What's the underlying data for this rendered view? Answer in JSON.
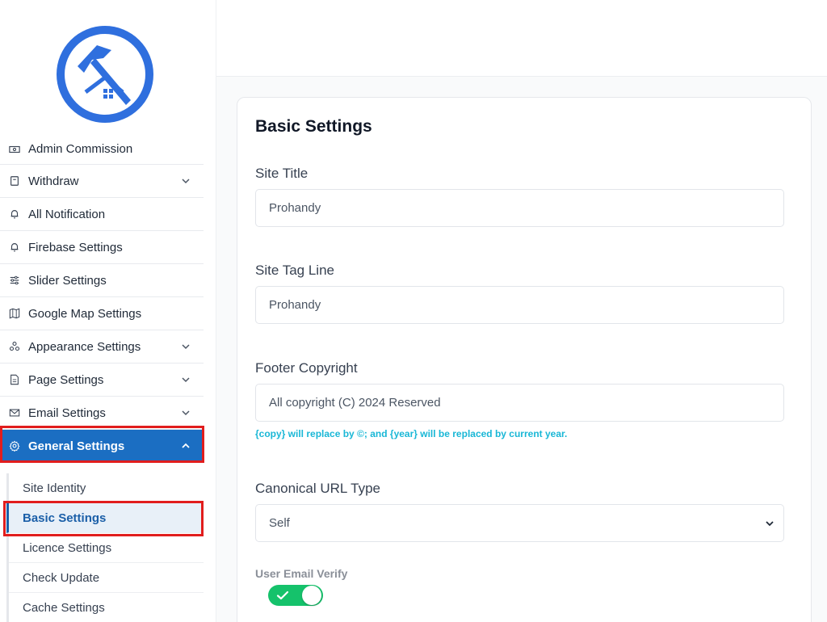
{
  "sidebar": {
    "items": [
      {
        "label": "Admin Commission",
        "icon": "cash-icon",
        "has_chevron": false
      },
      {
        "label": "Withdraw",
        "icon": "wallet-icon",
        "has_chevron": true
      },
      {
        "label": "All Notification",
        "icon": "bell-icon",
        "has_chevron": false
      },
      {
        "label": "Firebase Settings",
        "icon": "bell-icon",
        "has_chevron": false
      },
      {
        "label": "Slider Settings",
        "icon": "sliders-icon",
        "has_chevron": false
      },
      {
        "label": "Google Map Settings",
        "icon": "map-icon",
        "has_chevron": false
      },
      {
        "label": "Appearance Settings",
        "icon": "apps-icon",
        "has_chevron": true
      },
      {
        "label": "Page Settings",
        "icon": "page-icon",
        "has_chevron": true
      },
      {
        "label": "Email Settings",
        "icon": "mail-icon",
        "has_chevron": true
      },
      {
        "label": "General Settings",
        "icon": "gear-icon",
        "has_chevron": true,
        "active": true
      }
    ],
    "submenu": [
      {
        "label": "Site Identity"
      },
      {
        "label": "Basic Settings",
        "active": true
      },
      {
        "label": "Licence Settings"
      },
      {
        "label": "Check Update"
      },
      {
        "label": "Cache Settings"
      }
    ]
  },
  "form": {
    "title": "Basic Settings",
    "site_title_label": "Site Title",
    "site_title_value": "Prohandy",
    "tag_line_label": "Site Tag Line",
    "tag_line_value": "Prohandy",
    "footer_label": "Footer Copyright",
    "footer_value": "All copyright (C) 2024 Reserved",
    "footer_hint": "{copy} will replace by ©; and {year} will be replaced by current year.",
    "canonical_label": "Canonical URL Type",
    "canonical_value": "Self",
    "email_verify_label": "User Email Verify",
    "email_verify_on": true
  },
  "colors": {
    "brand": "#1b6ec2",
    "highlight_frame": "#e11d1d",
    "toggle_on": "#15c26b",
    "hint": "#19b7d6"
  }
}
